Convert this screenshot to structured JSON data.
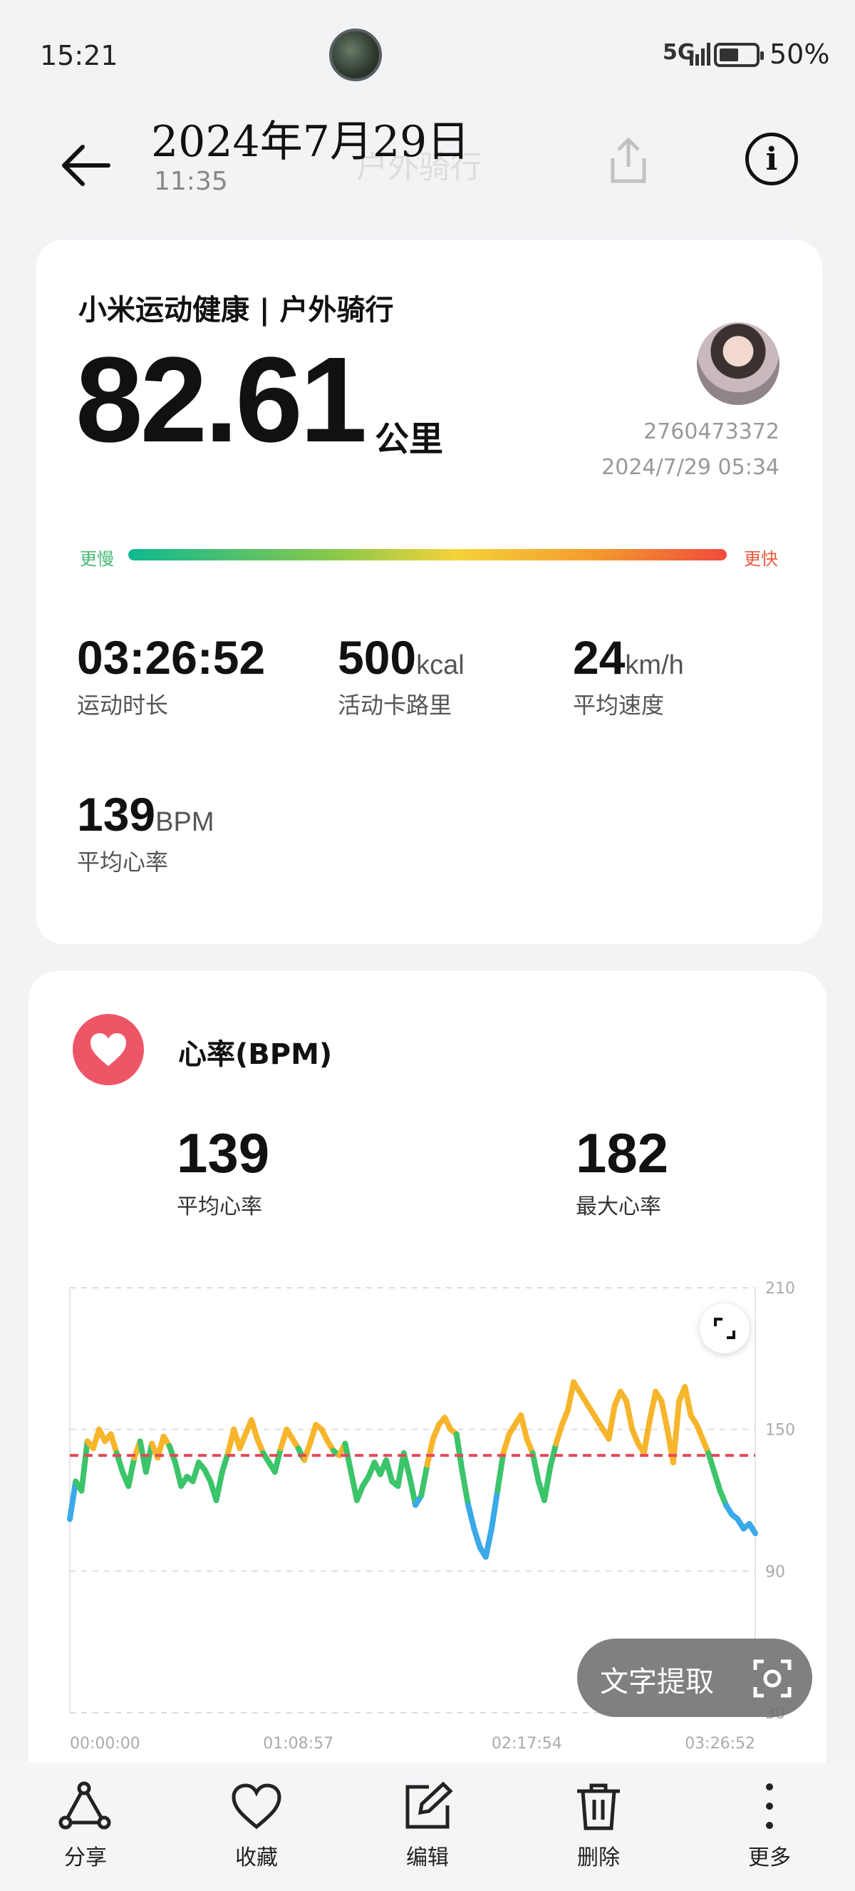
{
  "status_bar": {
    "time": "15:21",
    "network": "5G",
    "battery_percent": "50%",
    "battery_level": 0.5
  },
  "header": {
    "date": "2024年7月29日",
    "time": "11:35",
    "ghost_title": "户外骑行",
    "back_icon": "back-arrow-icon",
    "share_icon": "share-icon",
    "info_icon": "info-icon"
  },
  "summary": {
    "app_title": "小米运动健康 | 户外骑行",
    "distance": "82.61",
    "distance_unit": "公里",
    "user_id": "2760473372",
    "record_datetime": "2024/7/29 05:34",
    "slow_label": "更慢",
    "fast_label": "更快",
    "stats": [
      {
        "value": "03:26:52",
        "unit": "",
        "label": "运动时长"
      },
      {
        "value": "500",
        "unit": "kcal",
        "label": "活动卡路里"
      },
      {
        "value": "24",
        "unit": "km/h",
        "label": "平均速度"
      },
      {
        "value": "139",
        "unit": "BPM",
        "label": "平均心率"
      }
    ]
  },
  "heart_rate": {
    "title": "心率(BPM)",
    "avg_value": "139",
    "avg_label": "平均心率",
    "max_value": "182",
    "max_label": "最大心率",
    "icon": "heart-icon",
    "expand_icon": "expand-icon"
  },
  "chart_data": {
    "type": "line",
    "title": "",
    "xlabel": "",
    "ylabel": "",
    "x_tick_labels": [
      "00:00:00",
      "01:08:57",
      "02:17:54",
      "03:26:52"
    ],
    "y_ticks": [
      30,
      90,
      150,
      210
    ],
    "ylim": [
      30,
      210
    ],
    "average_line": 139,
    "grid": true,
    "color_zones": [
      {
        "max": 120,
        "color": "#3aa9e8"
      },
      {
        "max": 140,
        "color": "#3cc46a"
      },
      {
        "max": 170,
        "color": "#f7b52c"
      },
      {
        "max": 210,
        "color": "#ef5b4e"
      }
    ],
    "series": [
      {
        "values": [
          112,
          128,
          124,
          145,
          142,
          150,
          145,
          148,
          140,
          132,
          126,
          138,
          145,
          132,
          144,
          138,
          147,
          143,
          136,
          126,
          130,
          128,
          136,
          133,
          128,
          120,
          132,
          140,
          150,
          142,
          148,
          154,
          146,
          140,
          136,
          132,
          142,
          150,
          146,
          142,
          137,
          144,
          152,
          150,
          145,
          141,
          139,
          144,
          132,
          120,
          126,
          130,
          136,
          131,
          137,
          128,
          126,
          140,
          130,
          118,
          122,
          135,
          146,
          152,
          155,
          150,
          148,
          132,
          118,
          108,
          100,
          96,
          108,
          124,
          140,
          148,
          152,
          156,
          146,
          140,
          128,
          120,
          134,
          144,
          152,
          158,
          170,
          166,
          162,
          158,
          154,
          150,
          146,
          160,
          166,
          162,
          150,
          144,
          140,
          154,
          166,
          162,
          150,
          136,
          162,
          168,
          156,
          152,
          146,
          140,
          132,
          124,
          118,
          114,
          112,
          108,
          110,
          106
        ]
      }
    ]
  },
  "ocr_button": {
    "label": "文字提取",
    "icon": "scan-icon"
  },
  "bottom_bar": {
    "items": [
      {
        "label": "分享",
        "icon": "share-nodes-icon"
      },
      {
        "label": "收藏",
        "icon": "heart-outline-icon"
      },
      {
        "label": "编辑",
        "icon": "edit-icon"
      },
      {
        "label": "删除",
        "icon": "trash-icon"
      },
      {
        "label": "更多",
        "icon": "more-vertical-icon"
      }
    ]
  }
}
